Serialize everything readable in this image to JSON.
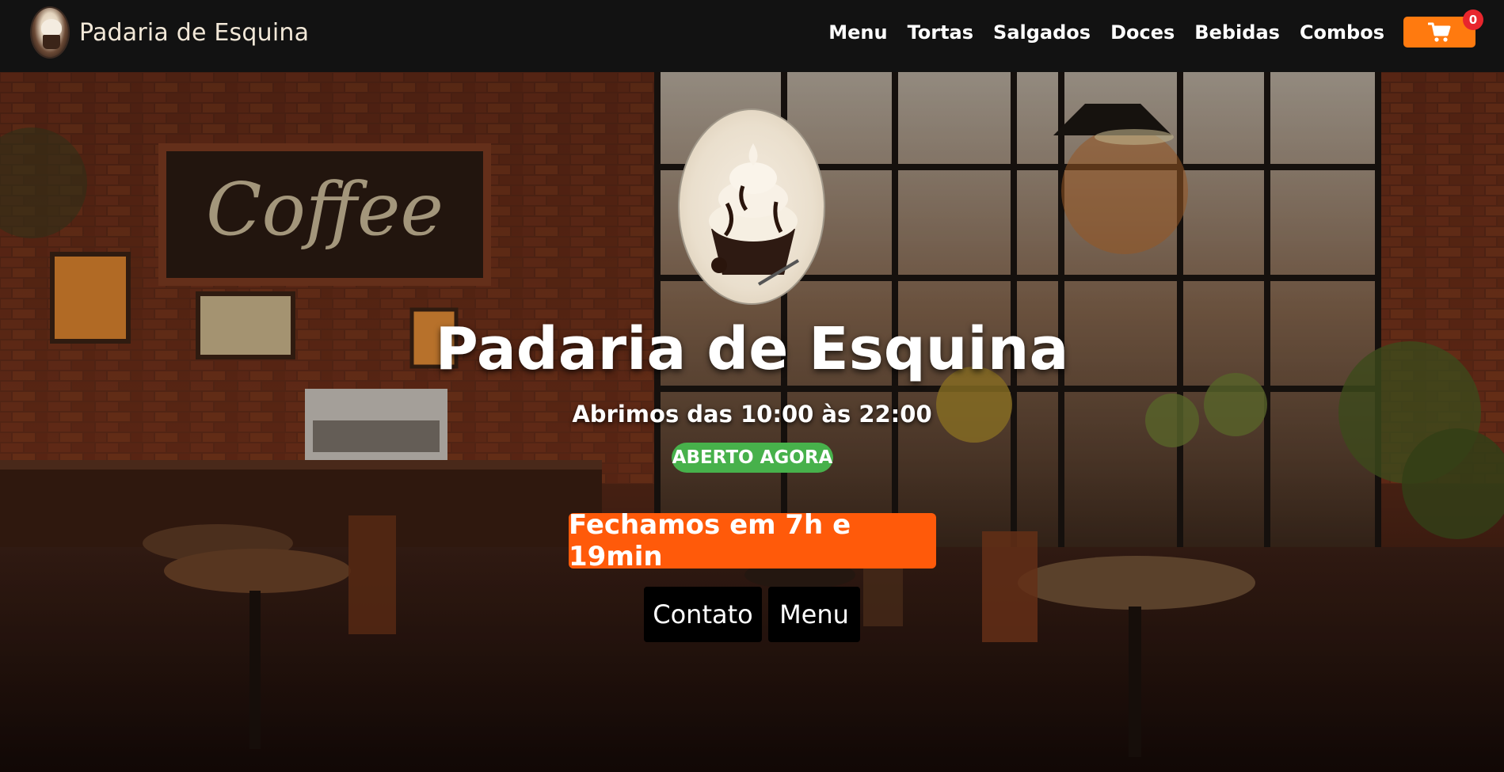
{
  "navbar": {
    "brand_name": "Padaria de Esquina",
    "links": [
      "Menu",
      "Tortas",
      "Salgados",
      "Doces",
      "Bebidas",
      "Combos"
    ],
    "cart_icon": "shopping-cart-icon",
    "cart_count": "0"
  },
  "hero": {
    "title": "Padaria de Esquina",
    "hours": "Abrimos das 10:00 às 22:00",
    "status": "ABERTO AGORA",
    "closing_text": "Fechamos em 7h e 19min",
    "buttons": {
      "contact": "Contato",
      "menu": "Menu"
    }
  },
  "colors": {
    "accent_orange": "#ff7a0f",
    "closing_orange": "#ff5a0a",
    "open_green": "#47b14b",
    "badge_red": "#e8262d",
    "navbar_bg": "#121212"
  }
}
